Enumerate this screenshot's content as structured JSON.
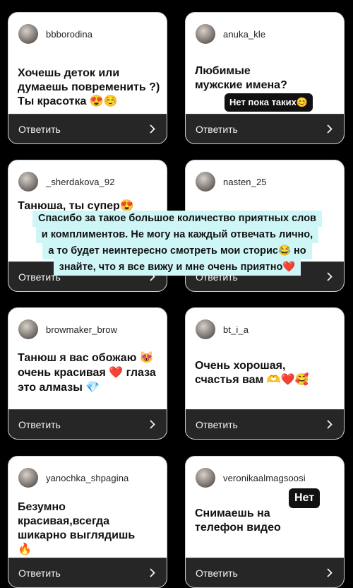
{
  "reply_label": "Ответить",
  "cards": [
    {
      "username": "bbborodina",
      "text": "Хочешь деток или думаешь повременить ?) Ты красотка 😍☺️"
    },
    {
      "username": "anuka_kle",
      "text": "Любимые мужские имена?",
      "sticker": "Нет пока таких😊"
    },
    {
      "username": "_sherdakova_92",
      "text": "Танюша, ты супер😍"
    },
    {
      "username": "nasten_25",
      "text": ""
    },
    {
      "username": "browmaker_brow",
      "text": "Танюш я вас обожаю 😻 очень красивая ❤️ глаза это алмазы 💎"
    },
    {
      "username": "bt_i_a",
      "text": "Очень хорошая, счастья вам 🫶❤️🥰"
    },
    {
      "username": "yanochka_shpagina",
      "text": "Безумно красивая,всегда шикарно выглядишь 🔥"
    },
    {
      "username": "veronikaalmagsoosi",
      "text": "Снимаешь на телефон видео",
      "sticker": "Нет"
    }
  ],
  "banner": {
    "lines": [
      "Спасибо за такое большое количество приятных слов",
      "и комплиментов. Не могу на каждый отвечать лично,",
      "а то будет неинтересно смотреть мои сторис😂 но",
      "знайте, что я все вижу и мне очень приятно❤️"
    ]
  },
  "colors": {
    "background": "#000000",
    "banner": "#cff6f6",
    "footer": "#262626"
  }
}
